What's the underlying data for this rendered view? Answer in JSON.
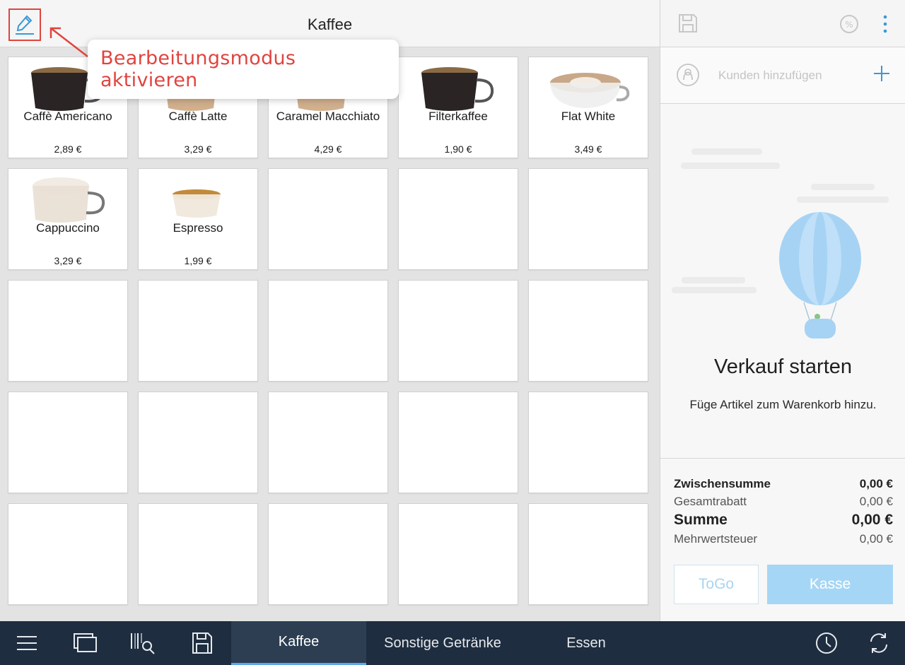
{
  "header": {
    "title": "Kaffee"
  },
  "annotation": {
    "text": "Bearbeitungsmodus aktivieren"
  },
  "products": [
    {
      "name": "Caffè Americano",
      "price": "2,89 €",
      "cup": "dark"
    },
    {
      "name": "Caffè Latte",
      "price": "3,29 €",
      "cup": "latte"
    },
    {
      "name": "Caramel Macchiato",
      "price": "4,29 €",
      "cup": "latte"
    },
    {
      "name": "Filterkaffee",
      "price": "1,90 €",
      "cup": "dark"
    },
    {
      "name": "Flat White",
      "price": "3,49 €",
      "cup": "flat"
    },
    {
      "name": "Cappuccino",
      "price": "3,29 €",
      "cup": "cappu"
    },
    {
      "name": "Espresso",
      "price": "1,99 €",
      "cup": "espresso"
    }
  ],
  "empty_tiles": 18,
  "customer": {
    "label": "Kunden hinzufügen"
  },
  "empty_cart": {
    "heading": "Verkauf starten",
    "sub": "Füge Artikel zum Warenkorb hinzu."
  },
  "totals": {
    "subtotal_label": "Zwischensumme",
    "subtotal_value": "0,00 €",
    "discount_label": "Gesamtrabatt",
    "discount_value": "0,00 €",
    "sum_label": "Summe",
    "sum_value": "0,00 €",
    "tax_label": "Mehrwertsteuer",
    "tax_value": "0,00 €"
  },
  "buttons": {
    "togo": "ToGo",
    "kasse": "Kasse"
  },
  "tabs": [
    {
      "label": "Kaffee",
      "active": true
    },
    {
      "label": "Sonstige Getränke",
      "active": false
    },
    {
      "label": "Essen",
      "active": false
    }
  ],
  "colors": {
    "accent": "#5aa9e6",
    "annotation": "#e0443f",
    "bottombar": "#1e2d3f"
  }
}
